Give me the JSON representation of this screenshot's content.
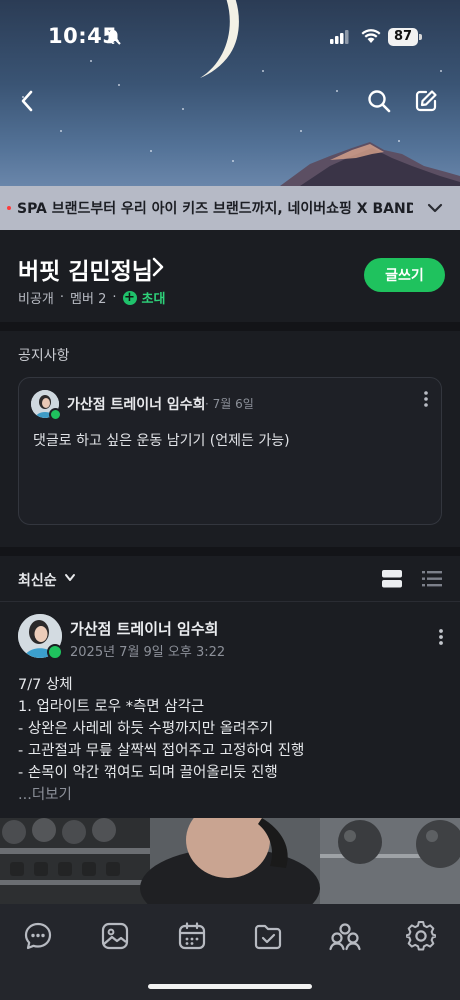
{
  "status_bar": {
    "time": "10:45",
    "battery": "87"
  },
  "ad_banner": {
    "text": "SPA 브랜드부터 우리 아이 키즈 브랜드까지, 네이버쇼핑 X BAND 단..."
  },
  "band": {
    "title": "버핏 김민정님",
    "privacy": "비공개",
    "members": "멤버 2",
    "invite_label": "초대",
    "write_button": "글쓰기"
  },
  "notice": {
    "heading": "공지사항",
    "author": "가산점 트레이너 임수희",
    "date": "· 7월 6일",
    "body": "댓글로 하고 싶은 운동 남기기 (언제든 가능)"
  },
  "sort": {
    "label": "최신순"
  },
  "post": {
    "author": "가산점 트레이너 임수희",
    "date": "2025년 7월 9일 오후 3:22",
    "lines": [
      "7/7 상체",
      "1. 업라이트 로우 *측면 삼각근",
      "- 상완은 사레레 하듯 수평까지만 올려주기",
      "- 고관절과 무릎 살짝씩 접어주고 고정하여 진행",
      "- 손목이 약간 꺾여도 되며 끌어올리듯 진행"
    ],
    "read_more": "...더보기"
  },
  "colors": {
    "accent_green": "#1fc25e",
    "background": "#1b1d22",
    "tabbar": "#24262c"
  },
  "tabs": [
    {
      "name": "chat-icon"
    },
    {
      "name": "photo-icon"
    },
    {
      "name": "calendar-icon"
    },
    {
      "name": "folder-check-icon"
    },
    {
      "name": "members-icon"
    },
    {
      "name": "settings-icon"
    }
  ]
}
